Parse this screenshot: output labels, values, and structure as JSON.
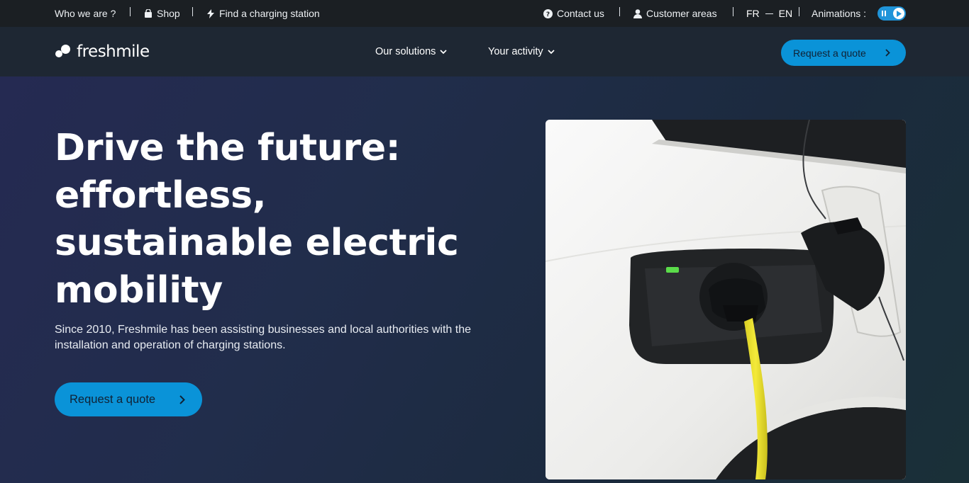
{
  "topbar": {
    "who_we_are": "Who we are ?",
    "shop": "Shop",
    "find_station": "Find a charging station",
    "contact_us": "Contact us",
    "customer_areas": "Customer areas",
    "lang_fr": "FR",
    "lang_en": "EN",
    "animations_label": "Animations :"
  },
  "header": {
    "logo_text": "freshmile",
    "nav": [
      {
        "label": "Our solutions",
        "icon": "chevron-down-icon"
      },
      {
        "label": "Your activity",
        "icon": "chevron-down-icon"
      }
    ],
    "cta_label": "Request a quote"
  },
  "hero": {
    "title_lines": [
      "Drive the future:",
      "effortless,",
      "sustainable electric",
      "mobility"
    ],
    "lead": "Since 2010, Freshmile has been assisting businesses and local authorities with the installation and operation of charging stations.",
    "cta_label": "Request a quote",
    "image_alt": "White electric car charging with a yellow cable"
  },
  "colors": {
    "accent": "#0a93d8",
    "topbar_bg": "#1b1f23",
    "header_bg": "#1e2733",
    "hero_bg": "#22294a"
  }
}
